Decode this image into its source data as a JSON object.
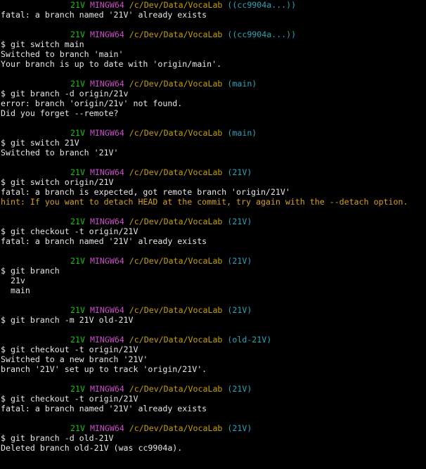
{
  "colors": {
    "background": "#000000",
    "text": "#e6e6e6",
    "user_host": "#16c60c",
    "msystem": "#c74ec6",
    "path": "#c4a000",
    "branch": "#2aa4b6",
    "hint": "#d4a017"
  },
  "lines": [
    {
      "type": "prompt",
      "host": "21V",
      "msys": "MINGW64",
      "path": "/c/Dev/Data/VocaLab",
      "branch": "((cc9904a...))"
    },
    {
      "type": "text",
      "text": "fatal: a branch named '21V' already exists"
    },
    {
      "type": "blank"
    },
    {
      "type": "prompt",
      "host": "21V",
      "msys": "MINGW64",
      "path": "/c/Dev/Data/VocaLab",
      "branch": "((cc9904a...))"
    },
    {
      "type": "text",
      "text": "$ git switch main"
    },
    {
      "type": "text",
      "text": "Switched to branch 'main'"
    },
    {
      "type": "text",
      "text": "Your branch is up to date with 'origin/main'."
    },
    {
      "type": "blank"
    },
    {
      "type": "prompt",
      "host": "21V",
      "msys": "MINGW64",
      "path": "/c/Dev/Data/VocaLab",
      "branch": "(main)"
    },
    {
      "type": "text",
      "text": "$ git branch -d origin/21v"
    },
    {
      "type": "text",
      "text": "error: branch 'origin/21v' not found."
    },
    {
      "type": "text",
      "text": "Did you forget --remote?"
    },
    {
      "type": "blank"
    },
    {
      "type": "prompt",
      "host": "21V",
      "msys": "MINGW64",
      "path": "/c/Dev/Data/VocaLab",
      "branch": "(main)"
    },
    {
      "type": "text",
      "text": "$ git switch 21V"
    },
    {
      "type": "text",
      "text": "Switched to branch '21V'"
    },
    {
      "type": "blank"
    },
    {
      "type": "prompt",
      "host": "21V",
      "msys": "MINGW64",
      "path": "/c/Dev/Data/VocaLab",
      "branch": "(21V)"
    },
    {
      "type": "text",
      "text": "$ git switch origin/21V"
    },
    {
      "type": "text",
      "text": "fatal: a branch is expected, got remote branch 'origin/21V'"
    },
    {
      "type": "hint",
      "text": "hint: If you want to detach HEAD at the commit, try again with the --detach option."
    },
    {
      "type": "blank"
    },
    {
      "type": "prompt",
      "host": "21V",
      "msys": "MINGW64",
      "path": "/c/Dev/Data/VocaLab",
      "branch": "(21V)"
    },
    {
      "type": "text",
      "text": "$ git checkout -t origin/21V"
    },
    {
      "type": "text",
      "text": "fatal: a branch named '21V' already exists"
    },
    {
      "type": "blank"
    },
    {
      "type": "prompt",
      "host": "21V",
      "msys": "MINGW64",
      "path": "/c/Dev/Data/VocaLab",
      "branch": "(21V)"
    },
    {
      "type": "text",
      "text": "$ git branch"
    },
    {
      "type": "text",
      "text": "  21v"
    },
    {
      "type": "text",
      "text": "  main"
    },
    {
      "type": "blank"
    },
    {
      "type": "prompt",
      "host": "21V",
      "msys": "MINGW64",
      "path": "/c/Dev/Data/VocaLab",
      "branch": "(21V)"
    },
    {
      "type": "text",
      "text": "$ git branch -m 21V old-21V"
    },
    {
      "type": "blank"
    },
    {
      "type": "prompt",
      "host": "21V",
      "msys": "MINGW64",
      "path": "/c/Dev/Data/VocaLab",
      "branch": "(old-21V)"
    },
    {
      "type": "text",
      "text": "$ git checkout -t origin/21V"
    },
    {
      "type": "text",
      "text": "Switched to a new branch '21V'"
    },
    {
      "type": "text",
      "text": "branch '21V' set up to track 'origin/21V'."
    },
    {
      "type": "blank"
    },
    {
      "type": "prompt",
      "host": "21V",
      "msys": "MINGW64",
      "path": "/c/Dev/Data/VocaLab",
      "branch": "(21V)"
    },
    {
      "type": "text",
      "text": "$ git checkout -t origin/21V"
    },
    {
      "type": "text",
      "text": "fatal: a branch named '21V' already exists"
    },
    {
      "type": "blank"
    },
    {
      "type": "prompt",
      "host": "21V",
      "msys": "MINGW64",
      "path": "/c/Dev/Data/VocaLab",
      "branch": "(21V)"
    },
    {
      "type": "text",
      "text": "$ git branch -d old-21V"
    },
    {
      "type": "text",
      "text": "Deleted branch old-21V (was cc9904a)."
    }
  ]
}
